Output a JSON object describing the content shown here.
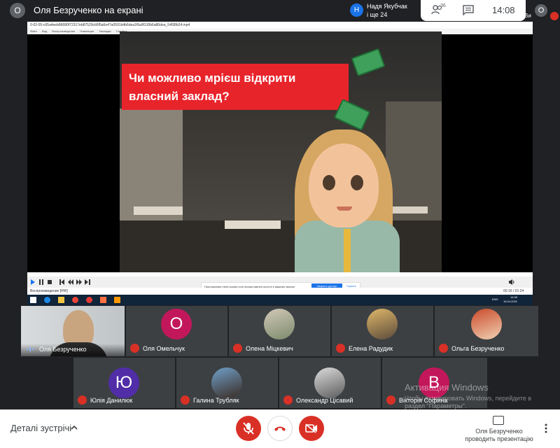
{
  "topbar": {
    "presenter_initial": "О",
    "title": "Оля Безрученко на екрані",
    "notification": {
      "initial": "Н",
      "line1": "Надя Якубчак",
      "line2": "і ще 24"
    },
    "people_count": "36",
    "clock": "14:08",
    "self_initial": "О",
    "self_label": "Ви"
  },
  "presentation": {
    "player_title": "0-02-05-c65a4eeb86680f72317eb87529cb5f5a6e47a0591b4b6dea1f6a9f130b6a80dea_54f38b24.mp4",
    "player_menu": "Файл Вид Воспроизведение Навигация Закладки Справка",
    "video_text_line1": "Чи можливо мрієш відкрити",
    "video_text_line2": "власний заклад?",
    "status": "Воспроизведение [HW]",
    "time_readout": "00:16 / 01:24",
    "download_prompt": "Приложению meet.google.com предоставлен доступ к вашему экрану.",
    "download_button": "Закрыть доступ",
    "download_hide": "Скрыть",
    "taskbar_lang": "ENG",
    "taskbar_time": "14:09",
    "taskbar_date": "16.04.2021"
  },
  "participants": [
    {
      "name": "Оля Безрученко",
      "type": "video",
      "muted": false
    },
    {
      "name": "Оля Омельчук",
      "type": "initial",
      "initial": "О",
      "color": "#c2185b",
      "muted": true
    },
    {
      "name": "Олена Міцкевич",
      "type": "photo",
      "muted": true
    },
    {
      "name": "Елена Радудик",
      "type": "photo",
      "muted": true
    },
    {
      "name": "Ольга Безрученко",
      "type": "photo",
      "muted": true
    },
    {
      "name": "Юлія Данилюк",
      "type": "initial",
      "initial": "Ю",
      "color": "#512da8",
      "muted": true
    },
    {
      "name": "Галина Трубляк",
      "type": "photo",
      "muted": true
    },
    {
      "name": "Олександр Цісавий",
      "type": "photo",
      "muted": true
    },
    {
      "name": "Вікторія Софина",
      "type": "initial",
      "initial": "В",
      "color": "#c2185b",
      "muted": true
    }
  ],
  "bottombar": {
    "details_label": "Деталі зустрічі",
    "mic_icon": "mic-off-icon",
    "hangup_icon": "phone-hangup-icon",
    "camera_icon": "camera-off-icon",
    "presenter_line1": "Оля Безрученко",
    "presenter_line2": "проводить презентацію"
  },
  "watermark": {
    "line1": "Активация Windows",
    "line2": "Чтобы активировать Windows, перейдите в раздел \"Параметры\"."
  },
  "colors": {
    "red": "#d93025",
    "background": "#202124",
    "accent_blue": "#1a73e8"
  }
}
